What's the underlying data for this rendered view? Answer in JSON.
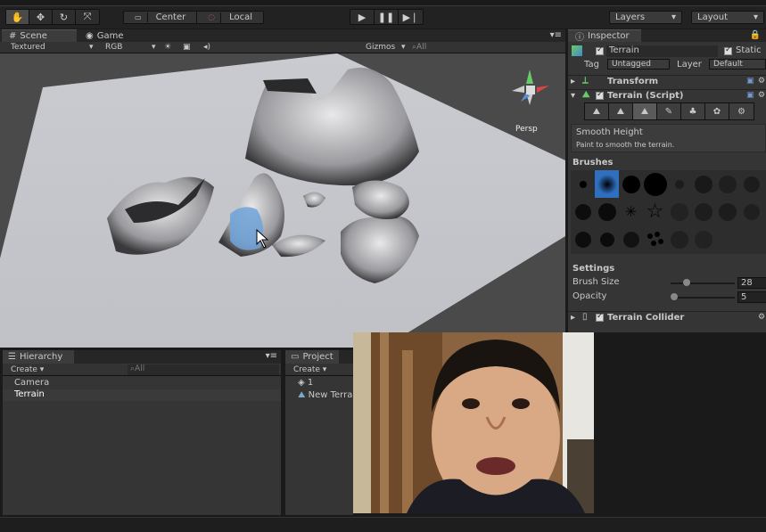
{
  "toolbar": {
    "tools": [
      {
        "icon": "hand-icon",
        "glyph": "✋"
      },
      {
        "icon": "move-icon",
        "glyph": "✥"
      },
      {
        "icon": "rotate-icon",
        "glyph": "↻"
      },
      {
        "icon": "scale-icon",
        "glyph": "⤧"
      }
    ],
    "pivot_center": "Center",
    "pivot_local": "Local",
    "layers_label": "Layers",
    "layout_label": "Layout"
  },
  "scene": {
    "tab_scene": "Scene",
    "tab_game": "Game",
    "render_mode": "Textured",
    "color_mode": "RGB",
    "gizmos_label": "Gizmos",
    "search_placeholder": "All",
    "gizmo_label": "Persp"
  },
  "inspector": {
    "tab_label": "Inspector",
    "object_name": "Terrain",
    "static_label": "Static",
    "tag_label": "Tag",
    "tag_value": "Untagged",
    "layer_label": "Layer",
    "layer_value": "Default",
    "transform_label": "Transform",
    "terrain_script_label": "Terrain (Script)",
    "tool_title": "Smooth Height",
    "tool_desc": "Paint to smooth the terrain.",
    "brushes_label": "Brushes",
    "settings_label": "Settings",
    "brush_size_label": "Brush Size",
    "brush_size_value": "28",
    "brush_size_fraction": 0.25,
    "opacity_label": "Opacity",
    "opacity_value": "5",
    "opacity_fraction": 0.05,
    "collider_label": "Terrain Collider"
  },
  "hierarchy": {
    "tab_label": "Hierarchy",
    "create_label": "Create",
    "search_placeholder": "All",
    "items": [
      "Camera",
      "Terrain"
    ],
    "selected": "Terrain"
  },
  "project": {
    "tab_label": "Project",
    "create_label": "Create",
    "items": [
      "1",
      "New Terra"
    ]
  },
  "colors": {
    "panel_bg": "#353535",
    "selection": "#3a3a3a",
    "brush_selected": "#2f6fbf"
  }
}
